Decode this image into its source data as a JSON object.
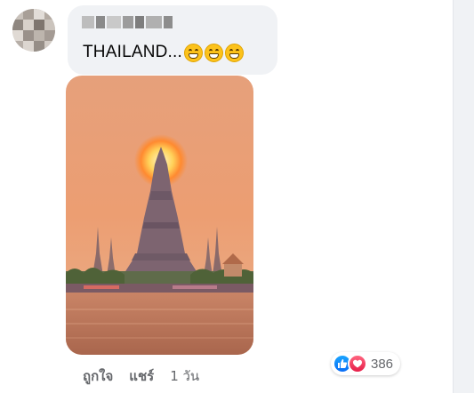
{
  "comment": {
    "author_name_blurred": "",
    "text": "THAILAND...",
    "emoji_count": 3,
    "emoji_name": "grinning-face-with-smiling-eyes"
  },
  "actions": {
    "like_label": "ถูกใจ",
    "reply_label": "แชร์",
    "time_label": "1 วัน"
  },
  "reactions": {
    "types": [
      "like",
      "love"
    ],
    "count": "386",
    "like_color": "#1877f2",
    "love_color": "#f33e58"
  },
  "photo": {
    "subject": "temple silhouette at sunset",
    "sky_color": "#e8a479",
    "water_color": "#b97457"
  }
}
